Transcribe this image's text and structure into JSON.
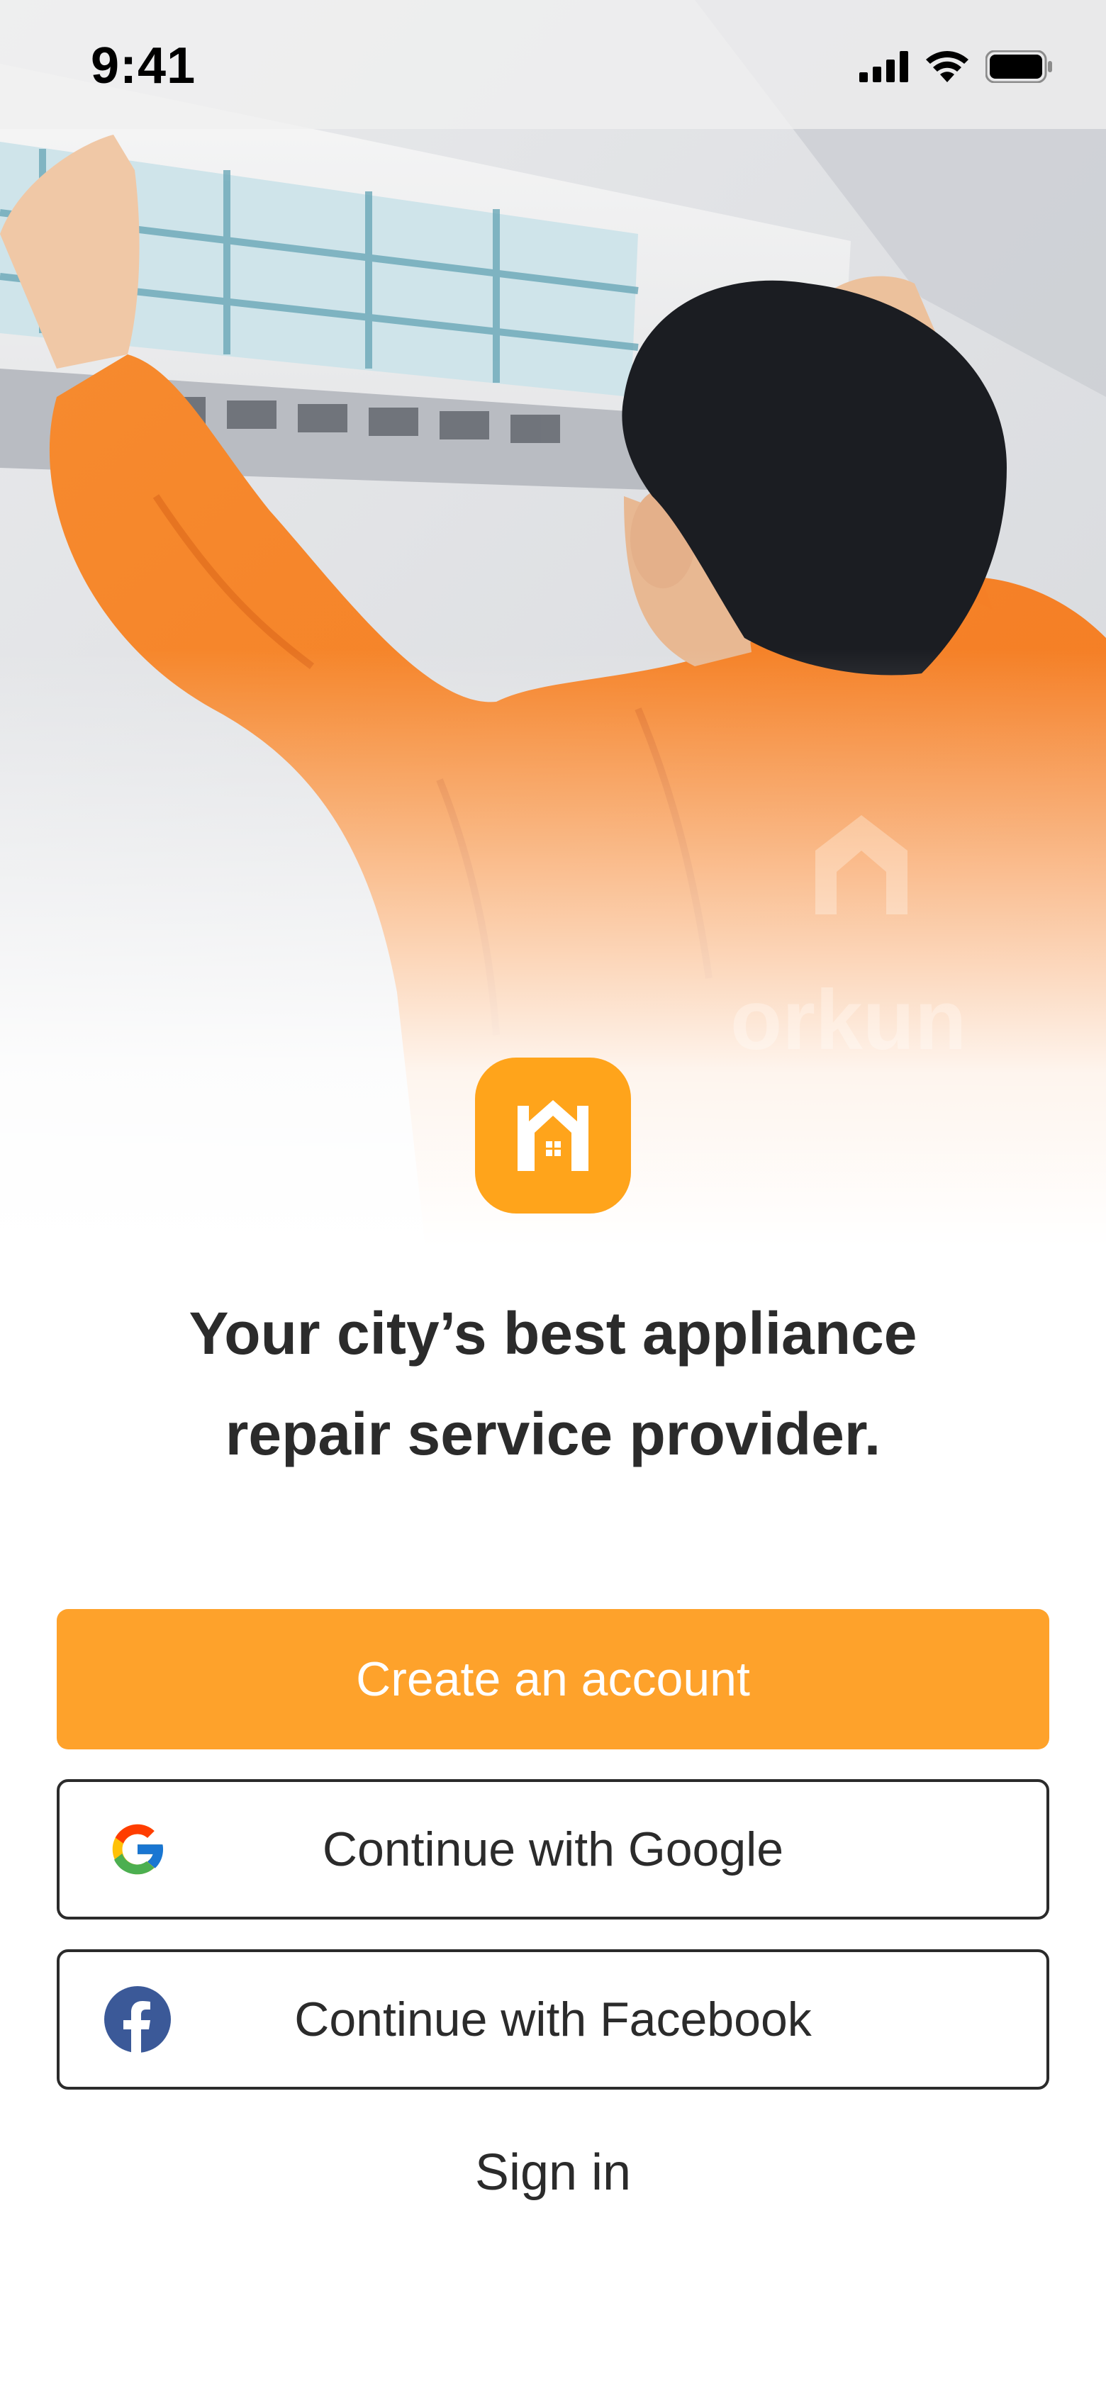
{
  "status_bar": {
    "time": "9:41",
    "icons": [
      "cellular-signal-icon",
      "wifi-icon",
      "battery-icon"
    ]
  },
  "hero": {
    "image": "technician-repairing-air-conditioner",
    "shirt_brand": "orkun"
  },
  "logo": {
    "icon": "house-logo-icon",
    "color": "#ffa41b"
  },
  "tagline": {
    "line1": "Your city’s best appliance",
    "line2": "repair service provider."
  },
  "actions": {
    "create_account": "Create an account",
    "google": "Continue with Google",
    "facebook": "Continue with Facebook",
    "sign_in": "Sign in"
  },
  "colors": {
    "accent": "#fea22b",
    "text": "#2b2b2b",
    "facebook": "#3b5998"
  }
}
